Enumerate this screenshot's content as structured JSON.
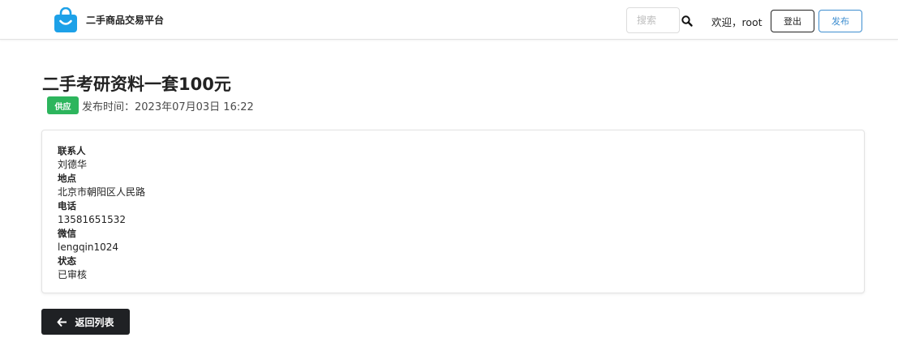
{
  "header": {
    "brand_name": "二手商品交易平台",
    "search_placeholder": "搜索",
    "welcome_text": "欢迎，root",
    "logout_label": "登出",
    "publish_label": "发布",
    "brand_color": "#1da1e8"
  },
  "post": {
    "title": "二手考研资料一套100元",
    "tag": "供应",
    "tag_color": "#2db55d",
    "published_text": "发布时间：2023年07月03日 16:22"
  },
  "details": [
    {
      "label": "联系人",
      "value": "刘德华"
    },
    {
      "label": "地点",
      "value": "北京市朝阳区人民路"
    },
    {
      "label": "电话",
      "value": "13581651532"
    },
    {
      "label": "微信",
      "value": "lengqin1024"
    },
    {
      "label": "状态",
      "value": "已审核"
    }
  ],
  "back_button": {
    "label": "返回列表",
    "icon": "arrow-left-icon"
  }
}
